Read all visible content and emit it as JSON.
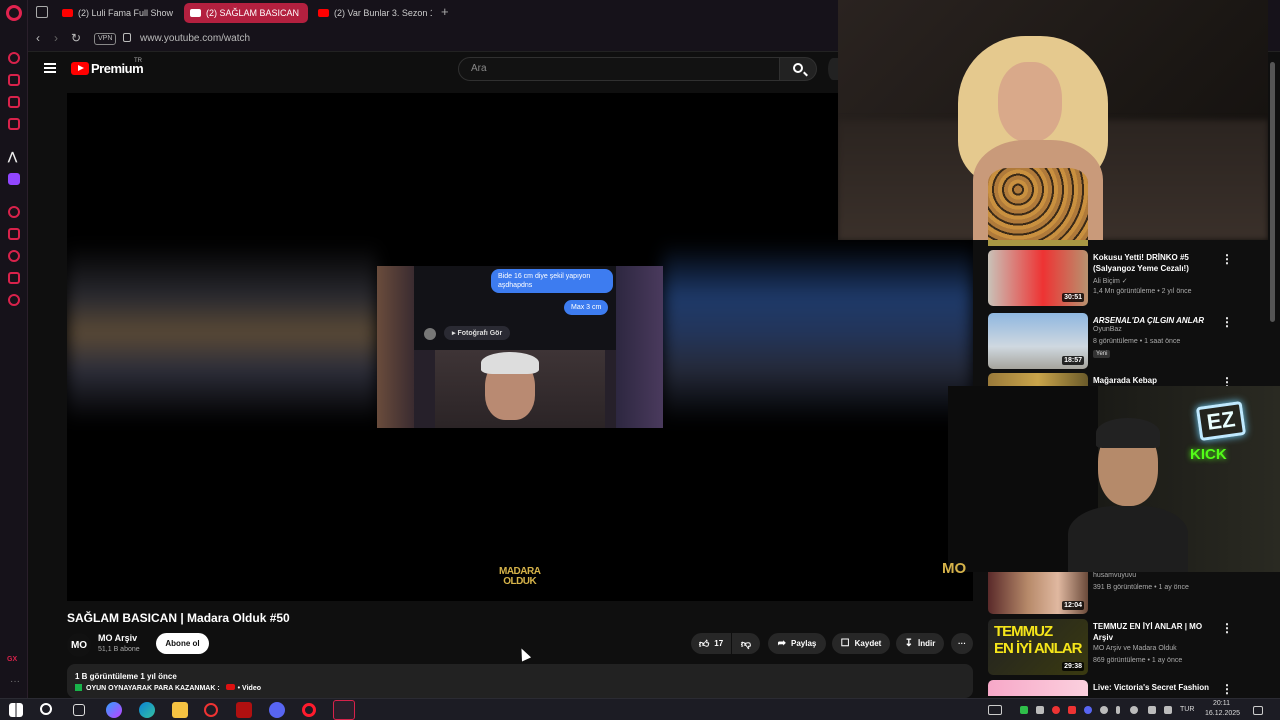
{
  "browser": {
    "tabs": [
      {
        "label": "(2) Luli Fama Full Show in"
      },
      {
        "label": "(2) SAĞLAM BASICAN"
      },
      {
        "label": "(2) Var Bunlar 3. Sezon 1."
      }
    ],
    "new_tab": "+",
    "vpn": "VPN",
    "url": "www.youtube.com/watch",
    "gx_label": "GX",
    "sidebar_more": "···"
  },
  "youtube": {
    "brand": "Premium",
    "brand_region": "TR",
    "search_placeholder": "Ara"
  },
  "video": {
    "title": "SAĞLAM BASICAN | Madara Olduk #50",
    "chat_bubble_1": "Bide 16 cm diye şekil yapıyon aşdhapdns",
    "chat_bubble_2": "Max 3 cm",
    "photo_button": "▸ Fotoğrafı Gör",
    "watermark_top": "MADARA",
    "watermark_bottom": "OLDUK",
    "channel": {
      "avatar": "MO",
      "name": "MO Arşiv",
      "subs": "51,1 B abone"
    },
    "subscribe": "Abone ol",
    "likes": "17",
    "share": "Paylaş",
    "save": "Kaydet",
    "download": "İndir",
    "more": "···",
    "description": {
      "stats": "1 B görüntüleme  1 yıl önce",
      "line2": "OYUN OYNAYARAK PARA KAZANMAK :",
      "line2_tail": "• Video"
    }
  },
  "overlay": {
    "ez": "EZ",
    "kick": "KICK",
    "logo": "MO"
  },
  "recommended": [
    {
      "title": "Kokusu Yetti! DRİNKO #5 (Salyangoz Yeme Cezalı!)",
      "channel": "Ali Biçim ✓",
      "meta": "1,4 Mn görüntüleme • 2 yıl önce",
      "duration": "30:51"
    },
    {
      "title": "ARSENAL'DA ÇILGIN ANLAR",
      "channel": "OyunBaz",
      "meta": "8 görüntüleme • 1 saat önce",
      "duration": "18:57",
      "badge": "Yeni"
    },
    {
      "title": "Mağarada Kebap",
      "channel": "",
      "meta": "",
      "duration": ""
    },
    {
      "title": "",
      "channel": "husamvuyuvu",
      "meta": "391 B görüntüleme • 1 ay önce",
      "duration": "12:04"
    },
    {
      "title": "TEMMUZ EN İYİ ANLAR | MO Arşiv",
      "channel": "MO Arşiv ve Madara Olduk",
      "meta": "869 görüntüleme • 1 ay önce",
      "duration": "29:38"
    },
    {
      "title": "Live: Victoria's Secret Fashion",
      "channel": "",
      "meta": "",
      "duration": ""
    }
  ],
  "taskbar": {
    "language": "TUR",
    "time": "20:11",
    "date": "16.12.2025"
  },
  "colors": {
    "accent": "#b3203f",
    "gx_red": "#d8224b",
    "youtube_red": "#ff0000",
    "kick_green": "#53fc18"
  }
}
